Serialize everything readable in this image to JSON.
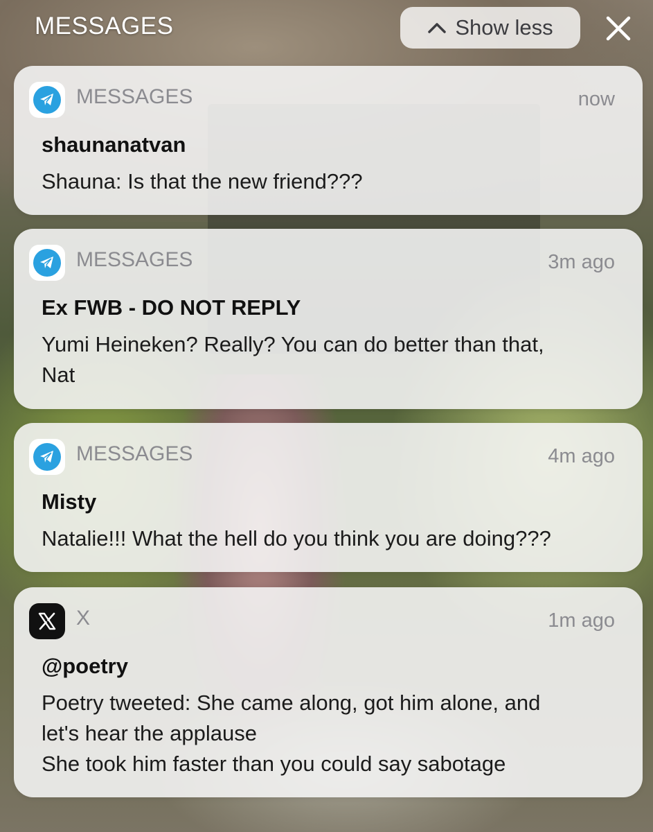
{
  "header": {
    "title": "MESSAGES",
    "show_less_label": "Show less",
    "close_icon": "close-icon"
  },
  "notifications": [
    {
      "app_icon": "telegram-icon",
      "app_name": "MESSAGES",
      "time": "now",
      "sender": "shaunanatvan",
      "body": "Shauna: Is that the new friend???"
    },
    {
      "app_icon": "telegram-icon",
      "app_name": "MESSAGES",
      "time": "3m ago",
      "sender": "Ex FWB - DO NOT REPLY",
      "body": "Yumi Heineken? Really? You can do better than that,\nNat"
    },
    {
      "app_icon": "telegram-icon",
      "app_name": "MESSAGES",
      "time": "4m ago",
      "sender": "Misty",
      "body": "Natalie!!! What the hell do you think you are doing???"
    },
    {
      "app_icon": "x-logo-icon",
      "app_name": "X",
      "time": "1m ago",
      "sender": "@poetry",
      "body": "Poetry tweeted: She came along, got him alone, and\nlet's hear the applause\nShe took him faster than you could say sabotage"
    }
  ],
  "colors": {
    "card_background": "#f6f6f6",
    "telegram_blue": "#2aa1e0",
    "x_black": "#111111",
    "secondary_text": "#8b8b90"
  }
}
